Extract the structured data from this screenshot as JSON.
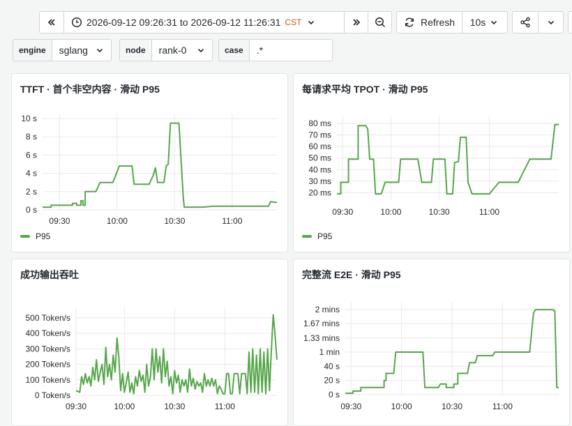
{
  "toolbar": {
    "time_range": "2026-09-12 09:26:31 to 2026-09-12 11:26:31",
    "timezone": "CST",
    "refresh_label": "Refresh",
    "refresh_interval": "10s"
  },
  "variables": [
    {
      "label": "engine",
      "value": "sglang"
    },
    {
      "label": "node",
      "value": "rank-0"
    },
    {
      "label": "case",
      "value": ".*"
    }
  ],
  "colors": {
    "series": "#56a64b",
    "grid": "#e9e9e9"
  },
  "panels": [
    {
      "title": "TTFT · 首个非空内容 · 滑动 P95",
      "legend": "P95"
    },
    {
      "title": "每请求平均 TPOT · 滑动 P95",
      "legend": "P95"
    },
    {
      "title": "成功输出吞吐",
      "legend": ""
    },
    {
      "title": "完整流 E2E · 滑动 P95",
      "legend": ""
    }
  ],
  "chart_data": [
    {
      "type": "line",
      "title": "TTFT · 首个非空内容 · 滑动 P95",
      "x_ticks": [
        "09:30",
        "10:00",
        "10:30",
        "11:00"
      ],
      "y_ticks": [
        "0 s",
        "2 s",
        "4 s",
        "6 s",
        "8 s",
        "10 s"
      ],
      "ylim": [
        0,
        10
      ],
      "y_unit": "s",
      "series": [
        {
          "name": "P95",
          "points": [
            [
              0,
              0.3
            ],
            [
              4,
              0.3
            ],
            [
              4,
              0.5
            ],
            [
              14,
              0.5
            ],
            [
              14,
              0.7
            ],
            [
              16,
              0.7
            ],
            [
              16,
              0.5
            ],
            [
              18,
              0.5
            ],
            [
              18,
              1.0
            ],
            [
              19,
              1.0
            ],
            [
              19,
              0.5
            ],
            [
              20,
              0.5
            ],
            [
              20,
              2.0
            ],
            [
              25,
              2.0
            ],
            [
              27,
              3.0
            ],
            [
              33,
              3.0
            ],
            [
              36,
              4.8
            ],
            [
              42,
              4.8
            ],
            [
              43,
              2.8
            ],
            [
              50,
              2.8
            ],
            [
              52,
              3.8
            ],
            [
              53,
              4.6
            ],
            [
              54,
              3.0
            ],
            [
              57,
              3.0
            ],
            [
              58,
              4.8
            ],
            [
              59,
              5.0
            ],
            [
              60,
              9.5
            ],
            [
              64,
              9.5
            ],
            [
              66,
              1.5
            ],
            [
              66.5,
              0.3
            ],
            [
              75,
              0.3
            ],
            [
              80,
              0.4
            ],
            [
              96,
              0.4
            ],
            [
              104,
              0.4
            ],
            [
              106,
              0.4
            ],
            [
              107,
              0.9
            ],
            [
              110,
              0.8
            ]
          ]
        }
      ]
    },
    {
      "type": "line",
      "title": "每请求平均 TPOT · 滑动 P95",
      "x_ticks": [
        "09:30",
        "10:00",
        "10:30",
        "11:00"
      ],
      "y_ticks": [
        "20 ms",
        "30 ms",
        "40 ms",
        "50 ms",
        "60 ms",
        "70 ms",
        "80 ms"
      ],
      "ylim": [
        13,
        83
      ],
      "y_unit": "ms",
      "series": [
        {
          "name": "P95",
          "points": [
            [
              0,
              19
            ],
            [
              2,
              19
            ],
            [
              2,
              29
            ],
            [
              6,
              29
            ],
            [
              6,
              49
            ],
            [
              11,
              49
            ],
            [
              11,
              78
            ],
            [
              15,
              78
            ],
            [
              16,
              75
            ],
            [
              17,
              49
            ],
            [
              19,
              49
            ],
            [
              20,
              19
            ],
            [
              23,
              19
            ],
            [
              25,
              29
            ],
            [
              32,
              29
            ],
            [
              33,
              49
            ],
            [
              42,
              49
            ],
            [
              44,
              29
            ],
            [
              49,
              29
            ],
            [
              50,
              49
            ],
            [
              56,
              49
            ],
            [
              57,
              19
            ],
            [
              60,
              19
            ],
            [
              61,
              46
            ],
            [
              63,
              47
            ],
            [
              64,
              68
            ],
            [
              67,
              68
            ],
            [
              68,
              29
            ],
            [
              70,
              19
            ],
            [
              79,
              19
            ],
            [
              84,
              29
            ],
            [
              94,
              29
            ],
            [
              100,
              49
            ],
            [
              111,
              49
            ],
            [
              113,
              79
            ],
            [
              115,
              79
            ]
          ]
        }
      ]
    },
    {
      "type": "line",
      "title": "成功输出吞吐",
      "x_ticks": [
        "09:30",
        "10:00",
        "10:30",
        "11:00"
      ],
      "y_ticks": [
        "0 Token/s",
        "100 Token/s",
        "200 Token/s",
        "300 Token/s",
        "400 Token/s",
        "500 Token/s"
      ],
      "ylim": [
        0,
        540
      ],
      "y_unit": "Token/s",
      "series": [
        {
          "name": "",
          "points": [
            [
              0,
              30
            ],
            [
              2,
              20
            ],
            [
              3,
              120
            ],
            [
              4,
              70
            ],
            [
              5,
              140
            ],
            [
              6,
              80
            ],
            [
              7,
              120
            ],
            [
              8,
              60
            ],
            [
              9,
              180
            ],
            [
              10,
              100
            ],
            [
              11,
              230
            ],
            [
              12,
              90
            ],
            [
              13,
              150
            ],
            [
              14,
              200
            ],
            [
              15,
              70
            ],
            [
              16,
              310
            ],
            [
              17,
              120
            ],
            [
              18,
              200
            ],
            [
              19,
              100
            ],
            [
              20,
              260
            ],
            [
              21,
              150
            ],
            [
              22,
              370
            ],
            [
              23,
              250
            ],
            [
              24,
              30
            ],
            [
              25,
              140
            ],
            [
              26,
              20
            ],
            [
              27,
              80
            ],
            [
              28,
              150
            ],
            [
              29,
              20
            ],
            [
              30,
              80
            ],
            [
              31,
              10
            ],
            [
              32,
              120
            ],
            [
              33,
              60
            ],
            [
              34,
              160
            ],
            [
              35,
              90
            ],
            [
              36,
              130
            ],
            [
              37,
              20
            ],
            [
              38,
              200
            ],
            [
              39,
              60
            ],
            [
              40,
              120
            ],
            [
              41,
              300
            ],
            [
              42,
              100
            ],
            [
              43,
              300
            ],
            [
              44,
              150
            ],
            [
              45,
              250
            ],
            [
              46,
              80
            ],
            [
              47,
              300
            ],
            [
              48,
              120
            ],
            [
              49,
              220
            ],
            [
              50,
              60
            ],
            [
              51,
              120
            ],
            [
              52,
              10
            ],
            [
              53,
              160
            ],
            [
              54,
              80
            ],
            [
              55,
              130
            ],
            [
              56,
              20
            ],
            [
              57,
              100
            ],
            [
              58,
              60
            ],
            [
              59,
              100
            ],
            [
              60,
              20
            ],
            [
              61,
              170
            ],
            [
              62,
              60
            ],
            [
              63,
              110
            ],
            [
              64,
              40
            ],
            [
              65,
              90
            ],
            [
              66,
              60
            ],
            [
              67,
              80
            ],
            [
              68,
              20
            ],
            [
              69,
              140
            ],
            [
              70,
              60
            ],
            [
              71,
              100
            ],
            [
              72,
              60
            ],
            [
              73,
              110
            ],
            [
              74,
              60
            ],
            [
              75,
              100
            ],
            [
              76,
              10
            ],
            [
              77,
              60
            ],
            [
              78,
              40
            ],
            [
              79,
              10
            ],
            [
              80,
              10
            ],
            [
              81,
              140
            ],
            [
              82,
              140
            ],
            [
              83,
              10
            ],
            [
              84,
              10
            ],
            [
              85,
              140
            ],
            [
              86,
              140
            ],
            [
              87,
              140
            ],
            [
              88,
              10
            ],
            [
              89,
              140
            ],
            [
              90,
              140
            ],
            [
              91,
              140
            ],
            [
              92,
              10
            ],
            [
              93,
              280
            ],
            [
              94,
              20
            ],
            [
              95,
              300
            ],
            [
              96,
              20
            ],
            [
              97,
              260
            ],
            [
              98,
              10
            ],
            [
              99,
              300
            ],
            [
              100,
              20
            ],
            [
              101,
              280
            ],
            [
              102,
              10
            ],
            [
              103,
              300
            ],
            [
              104,
              30
            ],
            [
              105,
              290
            ],
            [
              106,
              520
            ],
            [
              107,
              390
            ],
            [
              108,
              230
            ]
          ]
        }
      ]
    },
    {
      "type": "line",
      "title": "完整流 E2E · 滑动 P95",
      "x_ticks": [
        "09:30",
        "10:00",
        "10:30",
        "11:00"
      ],
      "y_ticks": [
        "0 s",
        "20 s",
        "40 s",
        "1 min",
        "1.33 mins",
        "1.67 mins",
        "2 mins"
      ],
      "ylim": [
        -1,
        125
      ],
      "y_unit": "s",
      "series": [
        {
          "name": "",
          "points": [
            [
              0,
              2
            ],
            [
              4,
              2
            ],
            [
              4,
              5
            ],
            [
              8,
              5
            ],
            [
              8,
              10
            ],
            [
              20,
              10
            ],
            [
              20,
              20
            ],
            [
              21,
              20
            ],
            [
              21,
              30
            ],
            [
              25,
              30
            ],
            [
              26,
              60
            ],
            [
              40,
              60
            ],
            [
              41,
              10
            ],
            [
              48,
              10
            ],
            [
              49,
              15
            ],
            [
              52,
              15
            ],
            [
              52,
              10
            ],
            [
              56,
              10
            ],
            [
              56,
              15
            ],
            [
              58,
              15
            ],
            [
              58,
              30
            ],
            [
              63,
              30
            ],
            [
              64,
              45
            ],
            [
              67,
              45
            ],
            [
              68,
              55
            ],
            [
              76,
              55
            ],
            [
              77,
              60
            ],
            [
              95,
              60
            ],
            [
              97,
              115
            ],
            [
              98,
              120
            ],
            [
              107,
              120
            ],
            [
              108,
              118
            ],
            [
              109,
              10
            ],
            [
              110,
              10
            ]
          ]
        }
      ]
    }
  ]
}
